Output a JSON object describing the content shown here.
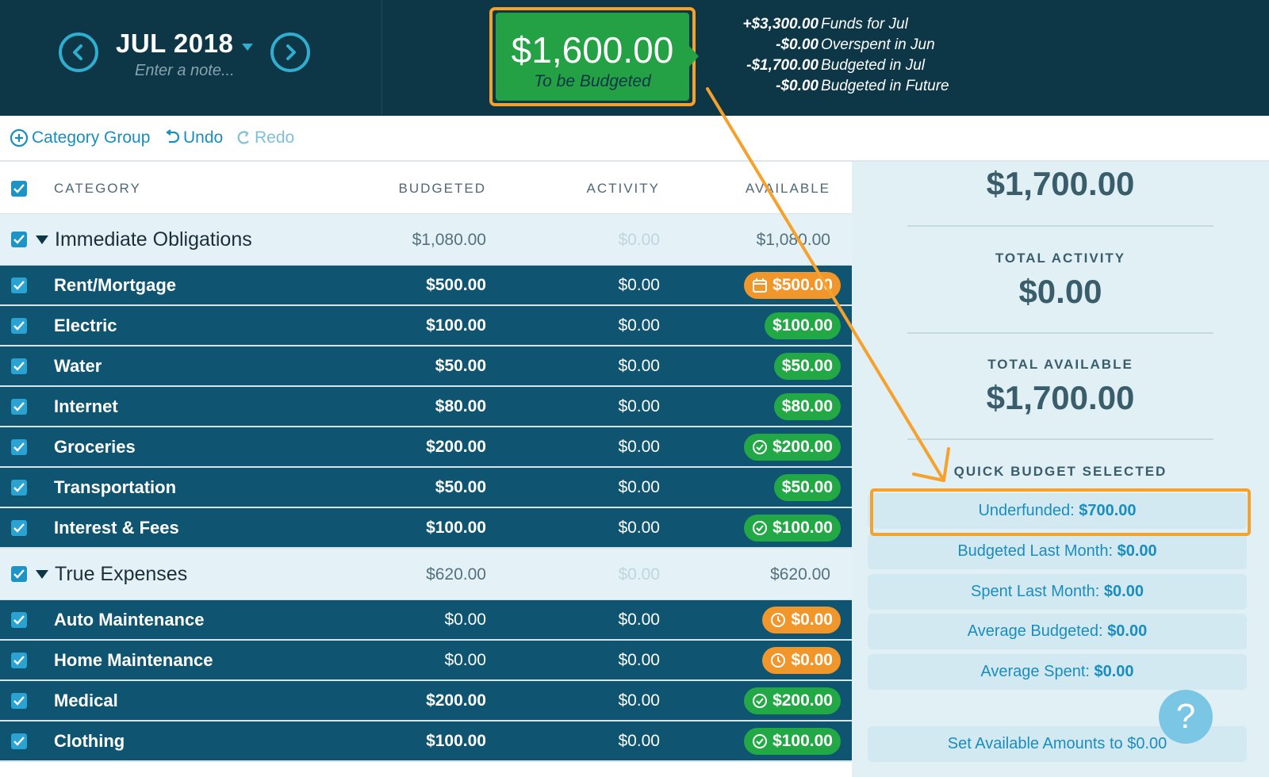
{
  "header": {
    "month": "JUL 2018",
    "note_placeholder": "Enter a note...",
    "to_be_budgeted": {
      "amount": "$1,600.00",
      "label": "To be Budgeted"
    },
    "funds_breakdown": [
      {
        "amount": "+$3,300.00",
        "description": "Funds for Jul"
      },
      {
        "amount": "-$0.00",
        "description": "Overspent in Jun"
      },
      {
        "amount": "-$1,700.00",
        "description": "Budgeted in Jul"
      },
      {
        "amount": "-$0.00",
        "description": "Budgeted in Future"
      }
    ],
    "icons": {
      "prev": "chevron-left-icon",
      "next": "chevron-right-icon"
    }
  },
  "toolbar": {
    "add_group_label": "Category Group",
    "undo_label": "Undo",
    "redo_label": "Redo"
  },
  "table": {
    "columns": {
      "category": "CATEGORY",
      "budgeted": "BUDGETED",
      "activity": "ACTIVITY",
      "available": "AVAILABLE"
    },
    "groups": [
      {
        "name": "Immediate Obligations",
        "budgeted": "$1,080.00",
        "activity": "$0.00",
        "available": "$1,080.00",
        "categories": [
          {
            "name": "Rent/Mortgage",
            "budgeted": "$500.00",
            "activity": "$0.00",
            "available": "$500.00",
            "status": "orange",
            "icon": "calendar-icon"
          },
          {
            "name": "Electric",
            "budgeted": "$100.00",
            "activity": "$0.00",
            "available": "$100.00",
            "status": "green",
            "icon": ""
          },
          {
            "name": "Water",
            "budgeted": "$50.00",
            "activity": "$0.00",
            "available": "$50.00",
            "status": "green",
            "icon": ""
          },
          {
            "name": "Internet",
            "budgeted": "$80.00",
            "activity": "$0.00",
            "available": "$80.00",
            "status": "green",
            "icon": ""
          },
          {
            "name": "Groceries",
            "budgeted": "$200.00",
            "activity": "$0.00",
            "available": "$200.00",
            "status": "green",
            "icon": "check-circle-icon"
          },
          {
            "name": "Transportation",
            "budgeted": "$50.00",
            "activity": "$0.00",
            "available": "$50.00",
            "status": "green",
            "icon": ""
          },
          {
            "name": "Interest & Fees",
            "budgeted": "$100.00",
            "activity": "$0.00",
            "available": "$100.00",
            "status": "green",
            "icon": "check-circle-icon"
          }
        ]
      },
      {
        "name": "True Expenses",
        "budgeted": "$620.00",
        "activity": "$0.00",
        "available": "$620.00",
        "categories": [
          {
            "name": "Auto Maintenance",
            "budgeted": "$0.00",
            "activity": "$0.00",
            "available": "$0.00",
            "status": "orange",
            "icon": "clock-icon"
          },
          {
            "name": "Home Maintenance",
            "budgeted": "$0.00",
            "activity": "$0.00",
            "available": "$0.00",
            "status": "orange",
            "icon": "clock-icon"
          },
          {
            "name": "Medical",
            "budgeted": "$200.00",
            "activity": "$0.00",
            "available": "$200.00",
            "status": "green",
            "icon": "check-circle-icon"
          },
          {
            "name": "Clothing",
            "budgeted": "$100.00",
            "activity": "$0.00",
            "available": "$100.00",
            "status": "green",
            "icon": "check-circle-icon"
          }
        ]
      }
    ]
  },
  "inspector": {
    "total_budgeted": "$1,700.00",
    "total_activity_label": "TOTAL ACTIVITY",
    "total_activity": "$0.00",
    "total_available_label": "TOTAL AVAILABLE",
    "total_available": "$1,700.00",
    "quick_budget_label": "QUICK BUDGET SELECTED",
    "quick_budget": [
      {
        "label": "Underfunded:",
        "value": "$700.00"
      },
      {
        "label": "Budgeted Last Month:",
        "value": "$0.00"
      },
      {
        "label": "Spent Last Month:",
        "value": "$0.00"
      },
      {
        "label": "Average Budgeted:",
        "value": "$0.00"
      },
      {
        "label": "Average Spent:",
        "value": "$0.00"
      }
    ],
    "set_available_label": "Set Available Amounts to $0.00",
    "help_label": "?"
  },
  "colors": {
    "header_bg": "#0d3646",
    "accent_blue": "#1a8dbf",
    "to_be_budgeted_green": "#24a144",
    "highlight_orange": "#f6a12b",
    "row_bg": "#0f5572",
    "pill_green": "#22a845",
    "pill_orange": "#f0962a"
  }
}
